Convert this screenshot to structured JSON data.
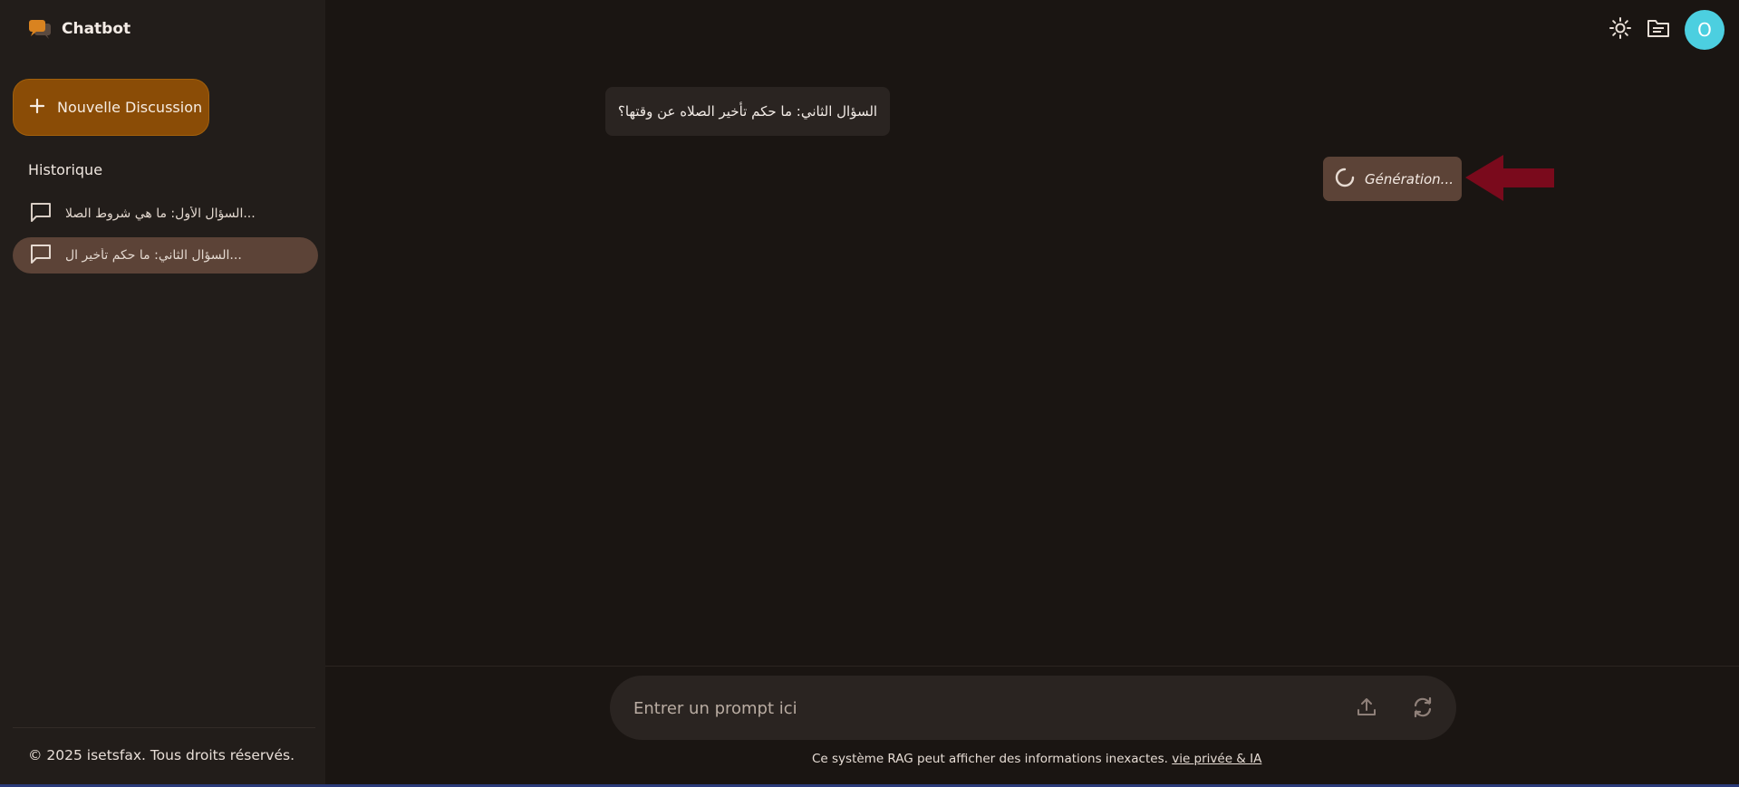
{
  "app": {
    "title": "Chatbot"
  },
  "sidebar": {
    "new_chat_label": "Nouvelle Discussion",
    "history_title": "Historique",
    "items": [
      {
        "label": "السؤال الأول: ما هي شروط الصلا...",
        "active": false
      },
      {
        "label": "السؤال الثاني: ما حكم تأخير ال...",
        "active": true
      }
    ],
    "copyright": "© 2025 isetsfax. Tous droits réservés."
  },
  "header": {
    "icons": [
      "sun-icon",
      "folder-icon"
    ],
    "avatar_initial": "O"
  },
  "conversation": {
    "user_message": "السؤال الثاني: ما حكم تأخير الصلاه عن وقتها؟",
    "generating_label": "Génération..."
  },
  "composer": {
    "placeholder": "Entrer un prompt ici",
    "disclaimer": "Ce système RAG peut afficher des informations inexactes.",
    "privacy_link": "vie privée & IA"
  },
  "colors": {
    "accent": "#8a4c06",
    "avatar": "#4ccfe0",
    "active_item": "#5c4337",
    "arrow": "#7a0a1c"
  }
}
